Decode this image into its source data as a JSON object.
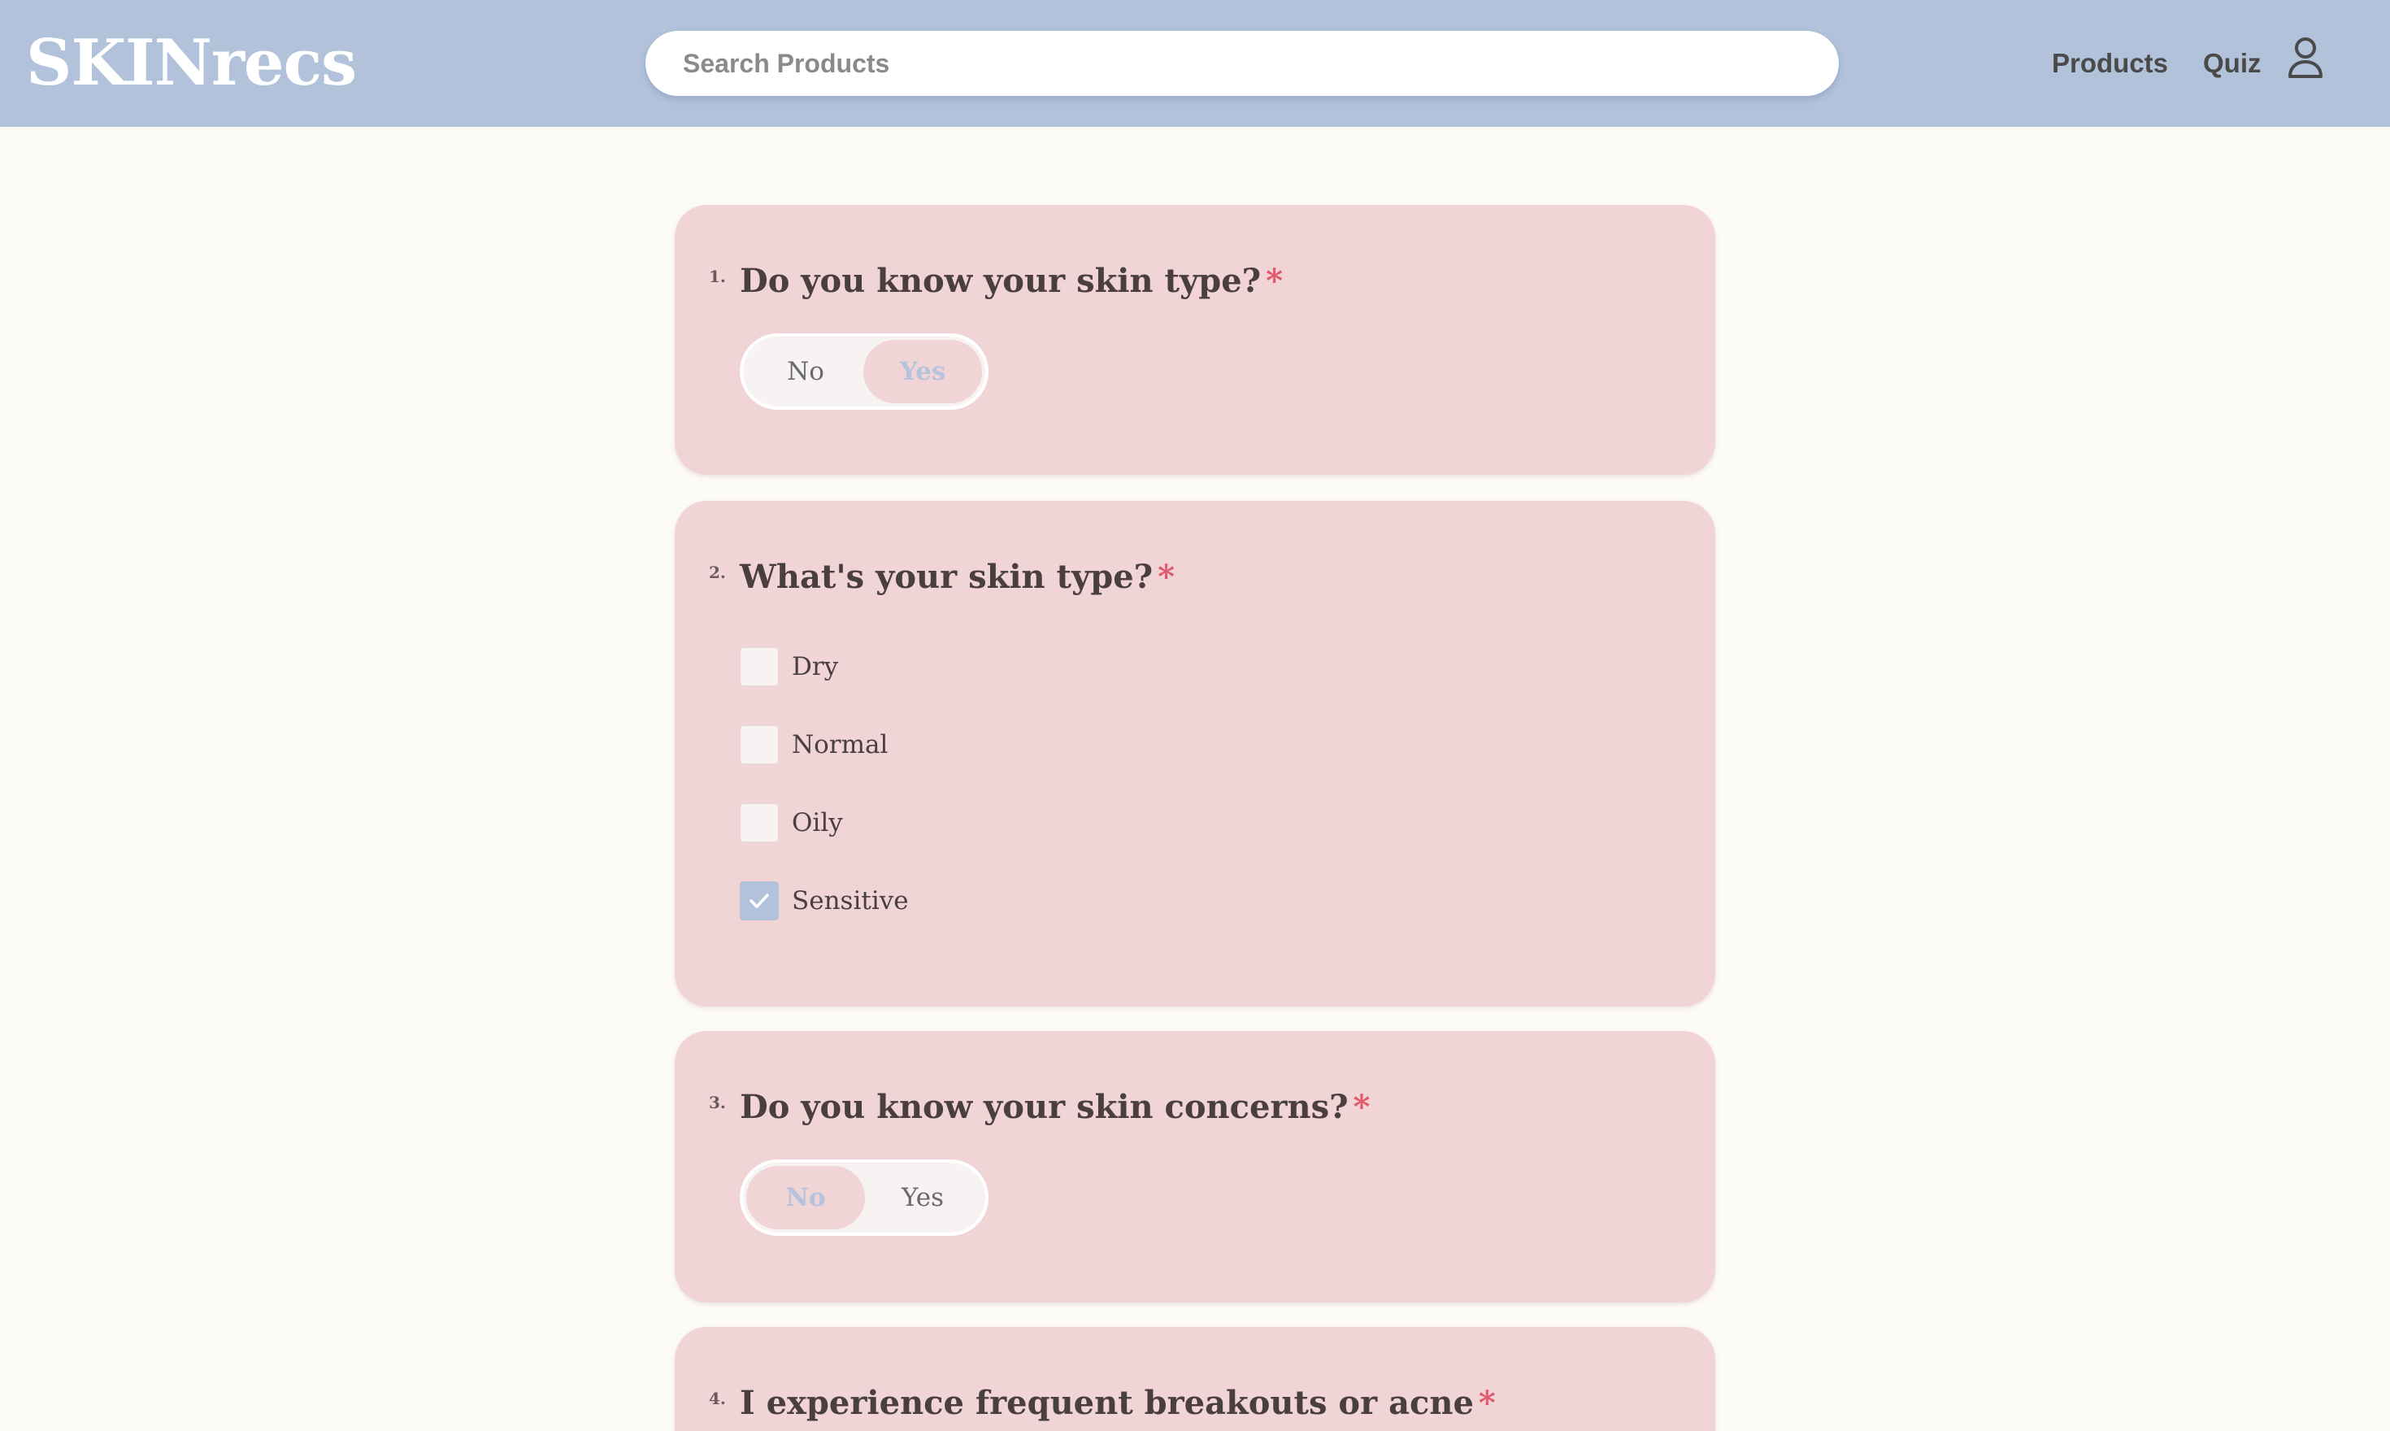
{
  "header": {
    "logo": "SKINrecs",
    "search_placeholder": "Search Products",
    "nav": {
      "products": "Products",
      "quiz": "Quiz"
    },
    "user_icon": "user-icon",
    "colors": {
      "header_bg": "#b1c2da",
      "card_bg": "#f1d4d5",
      "page_bg": "#fdfbf6",
      "required_star": "#e0586a"
    }
  },
  "questions": [
    {
      "number": "1.",
      "title": "Do you know your skin type?",
      "required": "*",
      "options": [
        "No",
        "Yes"
      ],
      "selected": "Yes"
    },
    {
      "number": "2.",
      "title": "What's your skin type?",
      "required": "*",
      "options": [
        {
          "label": "Dry",
          "checked": false
        },
        {
          "label": "Normal",
          "checked": false
        },
        {
          "label": "Oily",
          "checked": false
        },
        {
          "label": "Sensitive",
          "checked": true
        }
      ]
    },
    {
      "number": "3.",
      "title": "Do you know your skin concerns?",
      "required": "*",
      "options": [
        "No",
        "Yes"
      ],
      "selected": "No"
    },
    {
      "number": "4.",
      "title": "I experience frequent breakouts or acne",
      "required": "*"
    }
  ]
}
